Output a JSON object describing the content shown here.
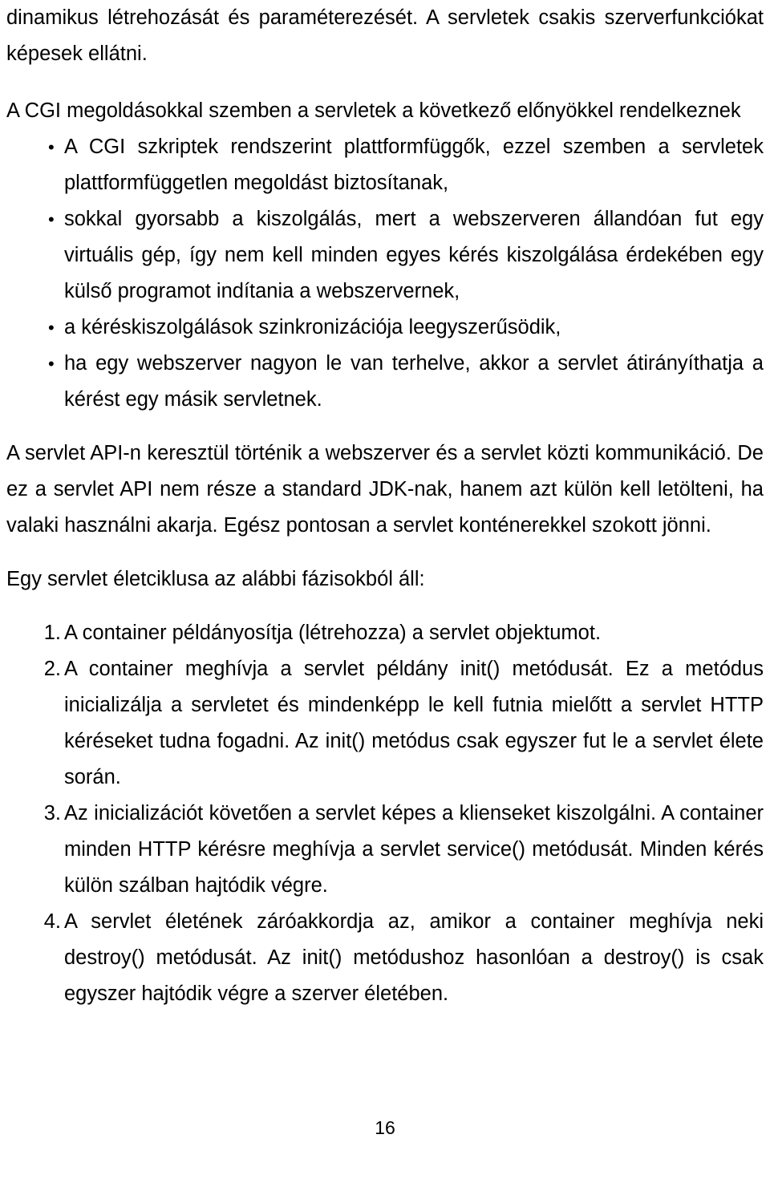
{
  "document": {
    "page_number": "16",
    "top_paragraph": "dinamikus létrehozását és paraméterezését. A servletek csakis szerverfunkciókat képesek ellátni.",
    "intro_paragraph": "A CGI megoldásokkal szemben a servletek a következő előnyökkel rendelkeznek",
    "advantages": [
      "A CGI szkriptek rendszerint plattformfüggők, ezzel szemben a servletek plattformfüggetlen megoldást biztosítanak,",
      "sokkal gyorsabb a kiszolgálás, mert a webszerveren állandóan fut egy virtuális gép, így nem kell minden egyes kérés kiszolgálása érdekében egy külső programot indítania a webszervernek,",
      "a kéréskiszolgálások szinkronizációja leegyszerűsödik,",
      "ha egy webszerver nagyon le van terhelve, akkor a servlet átirányíthatja a kérést egy másik servletnek."
    ],
    "api_paragraph": "A servlet API-n keresztül történik a webszerver és a servlet közti kommunikáció. De ez a servlet API nem része a standard JDK-nak, hanem azt külön kell letölteni, ha valaki használni akarja. Egész pontosan a servlet konténerekkel szokott jönni.",
    "lifecycle_intro": "Egy servlet életciklusa az alábbi fázisokból áll:",
    "lifecycle_steps": [
      {
        "marker": "1.",
        "text": "A container példányosítja (létrehozza) a servlet objektumot."
      },
      {
        "marker": "2.",
        "text": "A container meghívja a servlet példány init() metódusát. Ez a metódus inicializálja a servletet és mindenképp le kell futnia mielőtt a servlet HTTP kéréseket tudna fogadni. Az init() metódus csak egyszer fut le a servlet élete során."
      },
      {
        "marker": "3.",
        "text": "Az inicializációt követően a servlet képes a klienseket kiszolgálni. A container minden HTTP kérésre meghívja a servlet service() metódusát. Minden kérés külön szálban hajtódik végre."
      },
      {
        "marker": "4.",
        "text": "A servlet életének záróakkordja az, amikor a container meghívja neki destroy() metódusát. Az init() metódushoz hasonlóan a destroy() is csak egyszer hajtódik végre a szerver életében."
      }
    ],
    "bullet_glyph": "•"
  }
}
